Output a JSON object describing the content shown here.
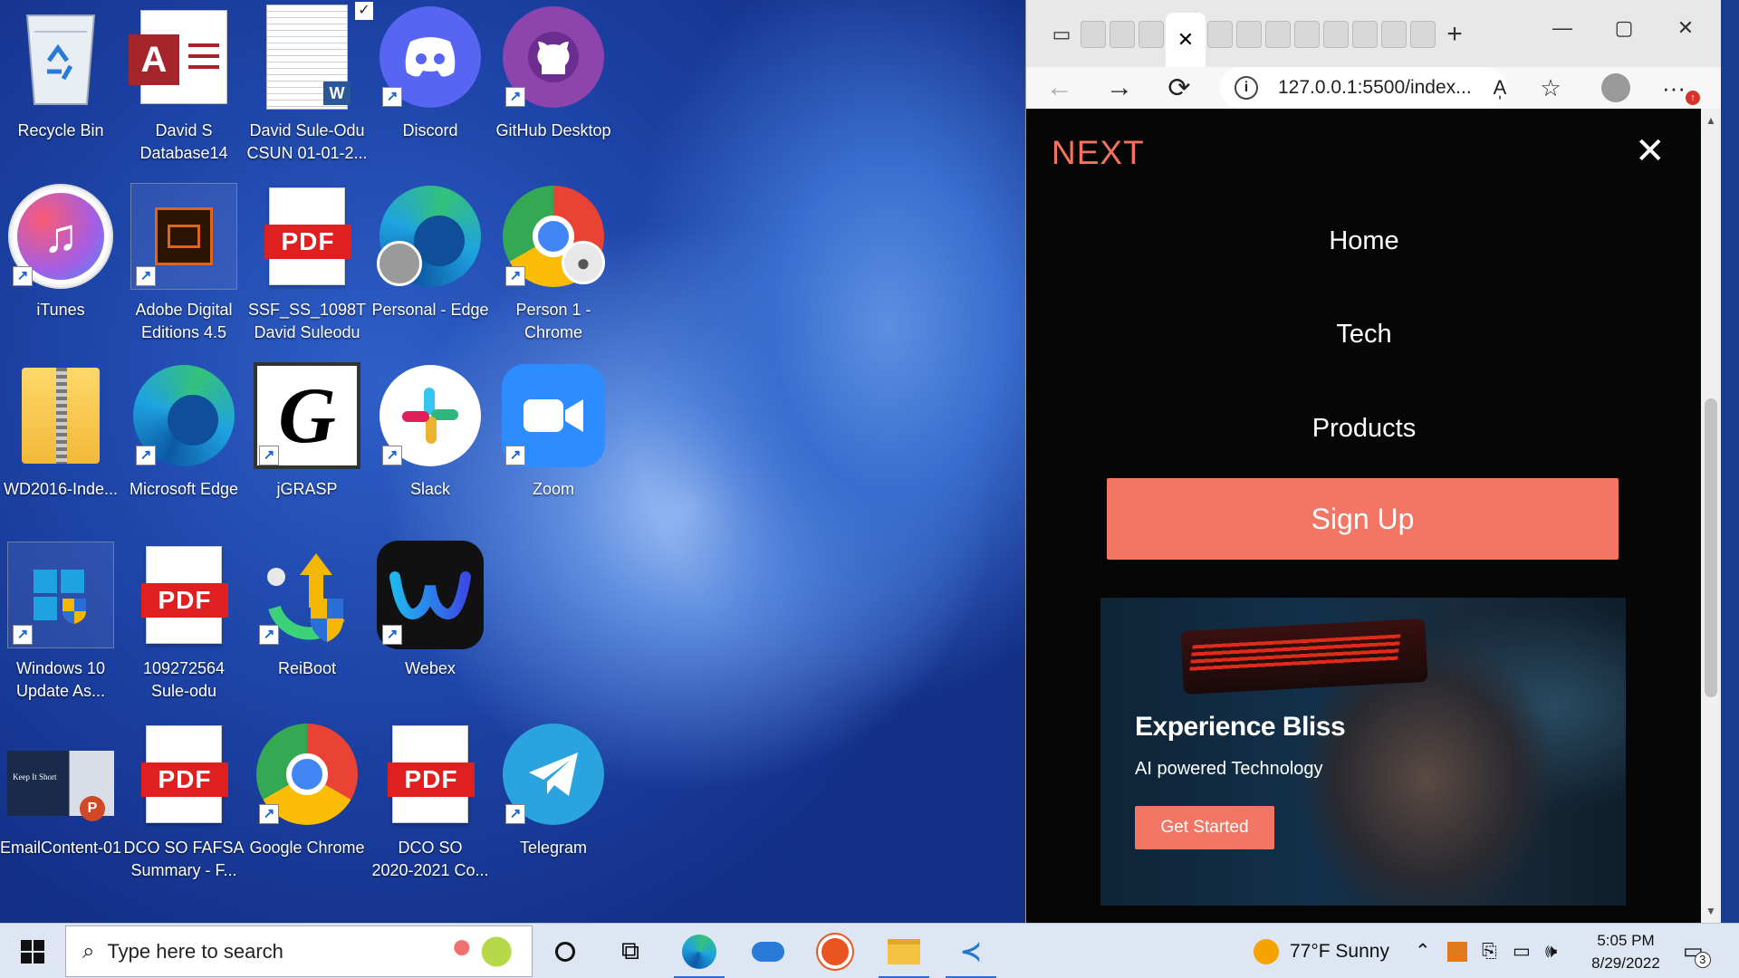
{
  "desktop": {
    "icons": [
      {
        "label": "Recycle Bin"
      },
      {
        "label": "David S\nDatabase14"
      },
      {
        "label": "David Sule-Odu\nCSUN 01-01-2..."
      },
      {
        "label": "Discord"
      },
      {
        "label": "GitHub Desktop"
      },
      {
        "label": "iTunes"
      },
      {
        "label": "Adobe Digital\nEditions 4.5"
      },
      {
        "label": "SSF_SS_1098T\nDavid Suleodu"
      },
      {
        "label": "Personal - Edge"
      },
      {
        "label": "Person 1 -\nChrome"
      },
      {
        "label": "WD2016-Inde..."
      },
      {
        "label": "Microsoft Edge"
      },
      {
        "label": "jGRASP"
      },
      {
        "label": "Slack"
      },
      {
        "label": "Zoom"
      },
      {
        "label": "Windows 10\nUpdate As..."
      },
      {
        "label": "109272564\nSule-odu"
      },
      {
        "label": "ReiBoot"
      },
      {
        "label": "Webex"
      },
      {
        "label": "EmailContent-01"
      },
      {
        "label": "DCO SO FAFSA\nSummary - F..."
      },
      {
        "label": "Google Chrome"
      },
      {
        "label": "DCO SO\n2020-2021 Co..."
      },
      {
        "label": "Telegram"
      }
    ],
    "pdf_text": "PDF",
    "access_letter": "A",
    "jgrasp_letter": "G",
    "word_letter": "W",
    "email_thumb_text": "Keep It Short"
  },
  "browser": {
    "url": "127.0.0.1:5500/index...",
    "read_aloud": "A̩",
    "site": {
      "logo": "NEXT",
      "close": "✕",
      "menu": [
        "Home",
        "Tech",
        "Products"
      ],
      "signup": "Sign Up",
      "hero": {
        "title": "Experience Bliss",
        "subtitle": "AI powered Technology",
        "button": "Get Started"
      }
    }
  },
  "taskbar": {
    "search_placeholder": "Type here to search",
    "weather": "77°F  Sunny",
    "time": "5:05 PM",
    "date": "8/29/2022",
    "notifications": "3"
  }
}
